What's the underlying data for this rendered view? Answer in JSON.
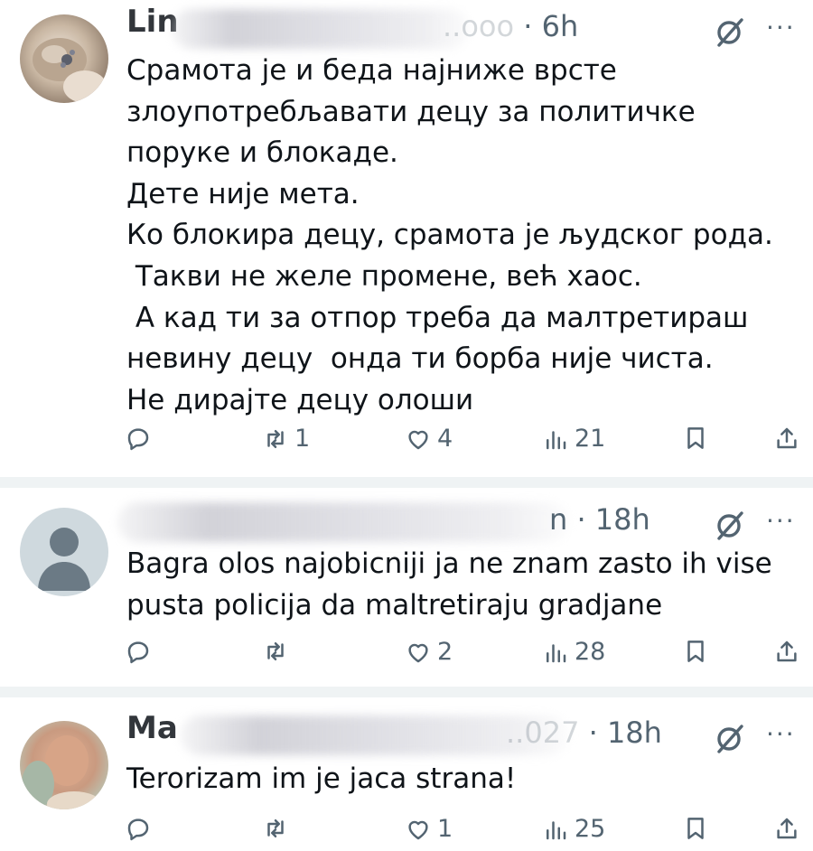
{
  "tweets": [
    {
      "name_fragment": "Lin",
      "handle_tail": "..ooo",
      "time": "6h",
      "body": "Срамота је и беда најниже врсте\nзлоупотребљавати децу за политичке\nпоруке и блокаде.\nДете није мета.\nКо блокира децу, срамота је људског рода.\n Такви не желе промене, већ хаос.\n А кад ти за отпор треба да малтретираш\nневину децу  онда ти борба није чиста.\nНе дирајте децу олоши",
      "replies": "",
      "reposts": "1",
      "likes": "4",
      "views": "21"
    },
    {
      "name_fragment": "",
      "handle_tail": "n",
      "time": "18h",
      "body": "Bagra olos najobicniji ja ne znam zasto ih vise\npusta policija da maltretiraju gradjane",
      "replies": "",
      "reposts": "",
      "likes": "2",
      "views": "28"
    },
    {
      "name_fragment": "Ma",
      "handle_tail": "..027",
      "time": "18h",
      "body": "Terorizam im je jaca strana!",
      "replies": "",
      "reposts": "",
      "likes": "1",
      "views": "25"
    }
  ],
  "icons": {
    "reply": "reply-icon",
    "repost": "repost-icon",
    "like": "heart-icon",
    "views": "views-icon",
    "bookmark": "bookmark-icon",
    "share": "share-icon",
    "grok": "grok-icon",
    "more": "more-icon"
  },
  "colors": {
    "muted": "#536471",
    "text": "#0f1419",
    "divider": "#eff3f4"
  }
}
